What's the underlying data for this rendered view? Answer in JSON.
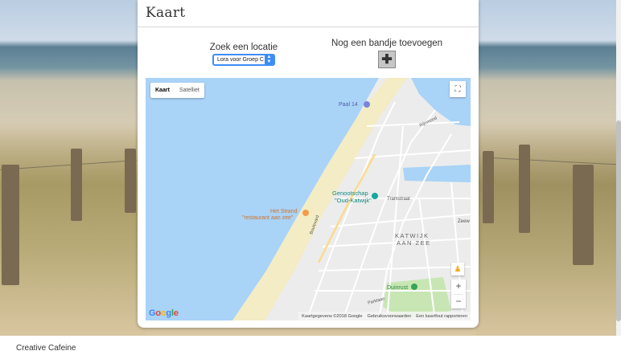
{
  "card": {
    "title": "Kaart"
  },
  "controls": {
    "location_label": "Zoek een locatie",
    "location_selected": "Lora voor Groep C",
    "add_label": "Nog een bandje toevoegen",
    "add_icon": "plus-icon"
  },
  "map": {
    "type_options": [
      {
        "label": "Kaart",
        "active": true
      },
      {
        "label": "Satelliet",
        "active": false
      }
    ],
    "labels": {
      "paal14": "Paal 14",
      "genootschap_1": "Genootschap",
      "genootschap_2": "\"Oud-Katwijk\"",
      "strand_1": "Het Strand",
      "strand_2": "\"restaurant aan zee\"",
      "katwijk_1": "KATWIJK",
      "katwijk_2": "AAN ZEE",
      "duinrust": "Duinrust",
      "tramstraat": "Tramstraat",
      "boulevard": "Boulevard",
      "rijnmond": "Rijnmond",
      "zeew": "Zeew",
      "parklaan": "Parklaan"
    },
    "google_logo": "Google",
    "attribution": {
      "data": "Kaartgegevens ©2018 Google",
      "terms": "Gebruiksvoorwaarden",
      "report": "Een kaartfout rapporteren"
    },
    "zoom_in": "+",
    "zoom_out": "−",
    "colors": {
      "water": "#a9d3f7",
      "sand": "#f3ecc4",
      "land": "#ececec",
      "park": "#c8e6b4",
      "road": "#ffffff"
    }
  },
  "footer": {
    "text": "Creative Cafeine"
  }
}
